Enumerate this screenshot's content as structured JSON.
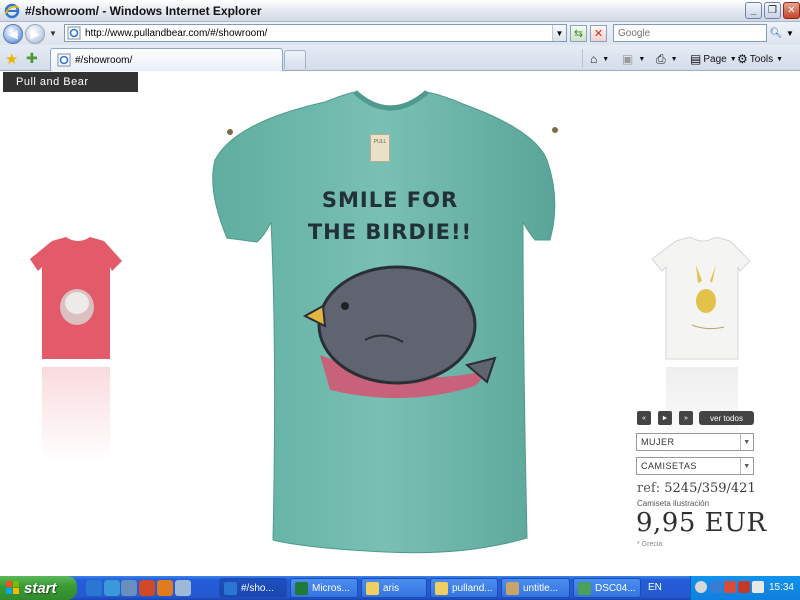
{
  "window": {
    "title": "#/showroom/ - Windows Internet Explorer",
    "minimize_label": "_",
    "maximize_label": "❐",
    "close_label": "✕"
  },
  "address_bar": {
    "url": "http://www.pullandbear.com/#/showroom/",
    "search_placeholder": "Google"
  },
  "tabs": [
    {
      "label": "#/showroom/"
    }
  ],
  "commands": {
    "page_label": "Page",
    "tools_label": "Tools"
  },
  "site": {
    "logo_text": "Pull and Bear",
    "main_product": {
      "print_line_1": "SMILE FOR",
      "print_line_2": "THE BIRDIE!!",
      "shirt_color": "#6fb8ad",
      "print_color": "#5f6470"
    },
    "side_products": [
      {
        "position": "prev",
        "shirt_color": "#e35a6a"
      },
      {
        "position": "next",
        "shirt_color": "#f4f4f2"
      }
    ],
    "controls": {
      "rewind_label": "«",
      "play_label": "►",
      "forward_label": "»",
      "view_all_label": "ver todos"
    },
    "filters": {
      "gender": "MUJER",
      "category": "CAMISETAS"
    },
    "product": {
      "ref_prefix": "ref:",
      "ref_code": "5245/359/421",
      "name": "Camiseta ilustración",
      "price": "9,95 EUR",
      "origin": "* Grecia"
    }
  },
  "taskbar": {
    "start_label": "start",
    "tasks": [
      {
        "label": "#/sho...",
        "active": true
      },
      {
        "label": "Micros...",
        "active": false
      },
      {
        "label": "aris",
        "active": false
      },
      {
        "label": "pulland...",
        "active": false
      },
      {
        "label": "untitle...",
        "active": false
      },
      {
        "label": "DSC04...",
        "active": false
      }
    ],
    "language": "EN",
    "clock": "15:34"
  },
  "colors": {
    "title_bar": "#dfe6ef",
    "taskbar": "#245edb",
    "start_button": "#3c9b37",
    "brand_bar": "#333333"
  }
}
